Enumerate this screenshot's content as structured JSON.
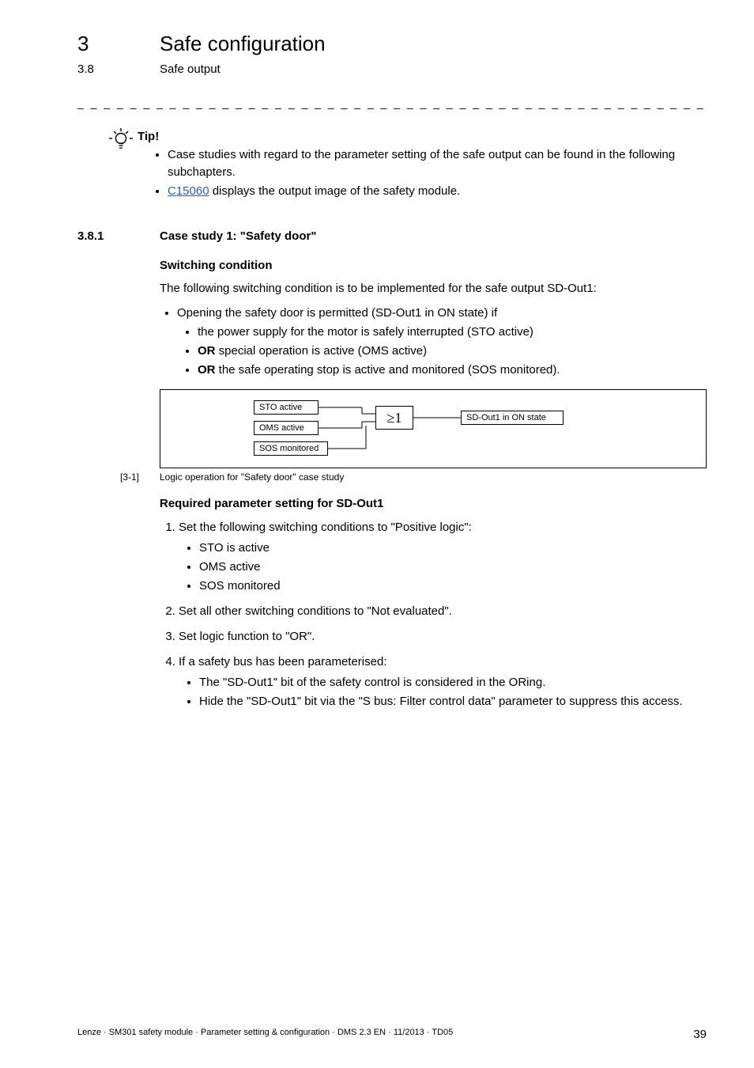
{
  "header": {
    "chapter_num": "3",
    "chapter_title": "Safe configuration",
    "section_num": "3.8",
    "section_title": "Safe output"
  },
  "tip": {
    "label": "Tip!",
    "items": [
      "Case studies with regard to the parameter setting of the safe output can be found in the following subchapters.",
      {
        "link": "C15060",
        "rest": " displays the output image of the safety module."
      }
    ]
  },
  "subsection": {
    "num": "3.8.1",
    "title": "Case study 1: \"Safety door\""
  },
  "switching": {
    "heading": "Switching condition",
    "intro": "The following switching condition is to be implemented for the safe output SD-Out1:",
    "top_item": "Opening the safety door is permitted (SD-Out1 in ON state) if",
    "sub_items": [
      "the power supply for the motor is safely interrupted (STO active)",
      {
        "bold": "OR",
        "rest": " special operation is active (OMS active)"
      },
      {
        "bold": "OR",
        "rest": " the safe operating stop is active and monitored (SOS monitored)."
      }
    ]
  },
  "diagram": {
    "boxes": {
      "sto": "STO active",
      "oms": "OMS active",
      "sos": "SOS monitored",
      "out": "SD-Out1 in ON state"
    },
    "gate": "≥1"
  },
  "figure": {
    "num": "[3-1]",
    "text": "Logic operation for \"Safety door\" case study"
  },
  "required": {
    "heading": "Required parameter setting for SD-Out1",
    "steps": [
      {
        "text": "Set the following switching conditions to \"Positive logic\":",
        "subs": [
          "STO is active",
          "OMS active",
          "SOS monitored"
        ]
      },
      {
        "text": "Set all other switching conditions to \"Not evaluated\"."
      },
      {
        "text": "Set logic function to \"OR\"."
      },
      {
        "text": "If a safety bus has been parameterised:",
        "subs": [
          "The \"SD-Out1\" bit of the safety control is considered in the ORing.",
          "Hide the \"SD-Out1\" bit via the \"S bus: Filter control data\" parameter to suppress this access."
        ]
      }
    ]
  },
  "footer": {
    "left": "Lenze · SM301 safety module · Parameter setting & configuration · DMS 2.3 EN · 11/2013 · TD05",
    "page": "39"
  }
}
